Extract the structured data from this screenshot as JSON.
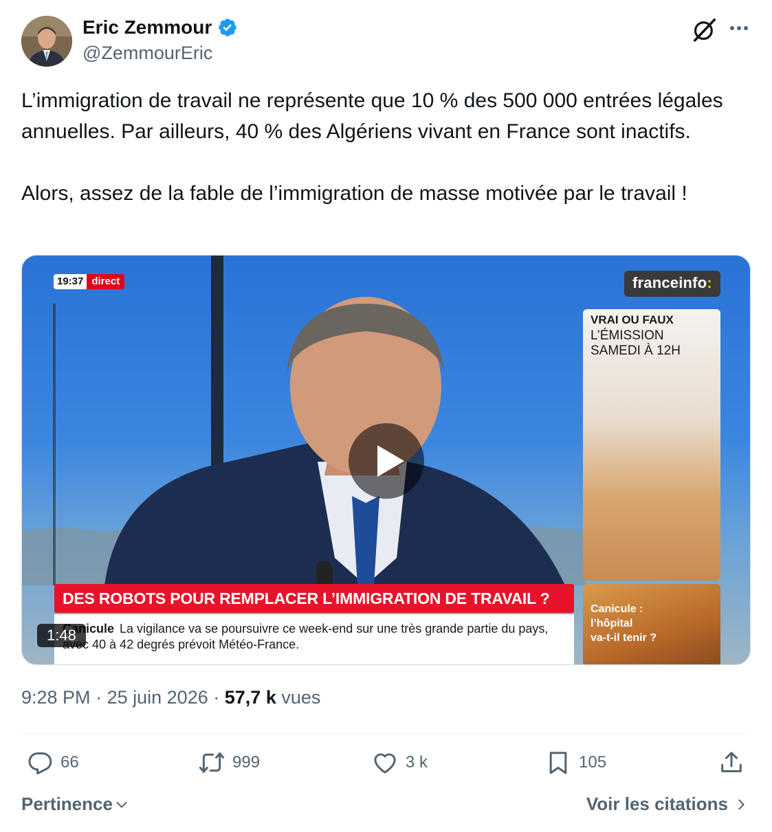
{
  "author": {
    "name": "Eric Zemmour",
    "handle": "@ZemmourEric",
    "verified": true,
    "accent_color": "#1d9bf0"
  },
  "tweet": {
    "text": "L’immigration de travail ne représente que 10 % des 500 000 entrées légales annuelles. Par ailleurs, 40 % des Algériens vivant en France sont inactifs.\n\nAlors, assez de la fable de l’immigration de masse motivée par le travail !"
  },
  "video": {
    "duration": "1:48",
    "overlay": {
      "clock": "19:37",
      "live_label": "direct",
      "channel": "franceinfo",
      "channel_suffix": ":",
      "promo_line1": "VRAI OU FAUX",
      "promo_line2": "L’ÉMISSION",
      "promo_line3": "SAMEDI À 12H",
      "promo2_text": "Canicule :\nl’hôpital\nva-t-il tenir ?",
      "headline": "DES ROBOTS POUR REMPLACER L’IMMIGRATION DE TRAVAIL ?",
      "ticker_keyword": "Canicule",
      "ticker_text": "La vigilance va se poursuivre ce week-end sur une très grande partie du pays, avec 40 à 42 degrés prévoit Météo-France."
    }
  },
  "meta": {
    "time": "9:28 PM",
    "separator": "·",
    "date": "25 juin 2026",
    "views_count": "57,7 k",
    "views_label": "vues"
  },
  "actions": {
    "replies": "66",
    "reposts": "999",
    "likes": "3 k",
    "bookmarks": "105"
  },
  "footer": {
    "sort_label": "Pertinence",
    "quotes_label": "Voir les citations"
  },
  "icons": [
    "verified-badge-icon",
    "grok-icon",
    "more-icon",
    "play-icon",
    "reply-icon",
    "repost-icon",
    "like-icon",
    "bookmark-icon",
    "share-icon",
    "chevron-down-icon",
    "chevron-right-icon"
  ]
}
